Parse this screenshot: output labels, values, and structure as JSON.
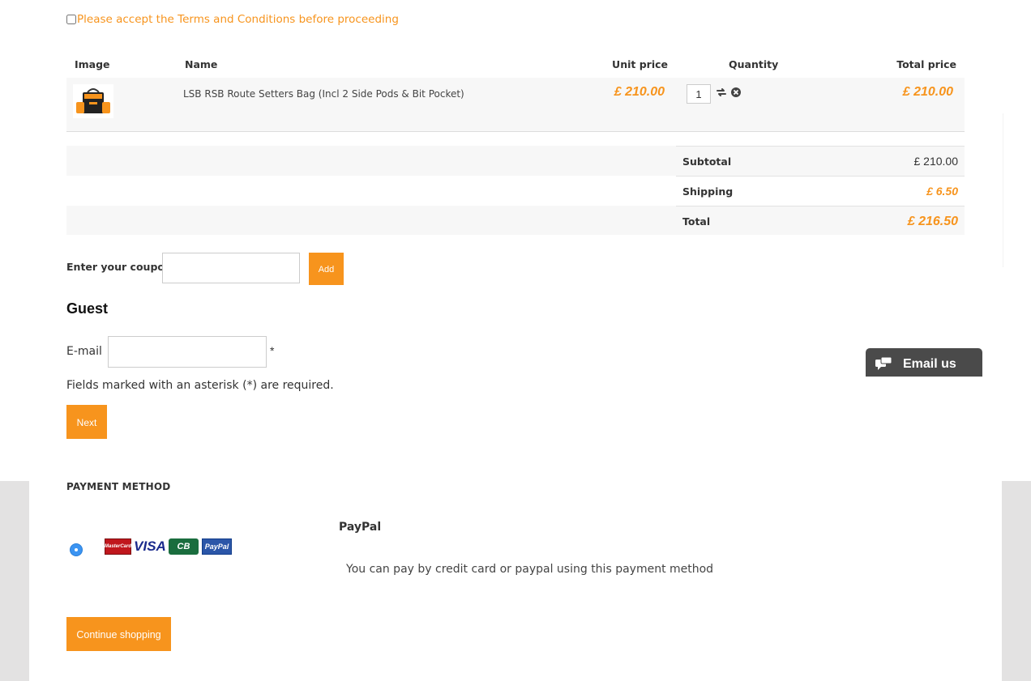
{
  "terms": {
    "label": "Please accept the Terms and Conditions before proceeding",
    "checked": false
  },
  "cart": {
    "headers": {
      "image": "Image",
      "name": "Name",
      "unit_price": "Unit price",
      "quantity": "Quantity",
      "total_price": "Total price"
    },
    "items": [
      {
        "name": "LSB RSB Route Setters Bag (Incl 2 Side Pods & Bit Pocket)",
        "unit_price": "£ 210.00",
        "quantity": "1",
        "total_price": "£ 210.00",
        "image_icon": "bag-product-image",
        "update_icon": "refresh-icon",
        "remove_icon": "remove-icon"
      }
    ]
  },
  "summary": {
    "subtotal_label": "Subtotal",
    "subtotal": "£ 210.00",
    "shipping_label": "Shipping",
    "shipping": "£ 6.50",
    "total_label": "Total",
    "total": "£ 216.50"
  },
  "coupon": {
    "label": "Enter your coupon",
    "value": "",
    "add_label": "Add"
  },
  "guest": {
    "title": "Guest",
    "email_label": "E-mail",
    "email_value": "",
    "required_star": "*",
    "required_note": "Fields marked with an asterisk (*) are required.",
    "next_label": "Next"
  },
  "widget": {
    "email_us": "Email us",
    "icon": "chat-icon"
  },
  "payment": {
    "title": "PAYMENT METHOD",
    "method_name": "PayPal",
    "method_desc": "You can pay by credit card or paypal using this payment method",
    "selected": true,
    "cards": {
      "mastercard": "MasterCard",
      "visa": "VISA",
      "cb": "CB",
      "paypal": "PayPal"
    }
  },
  "footer": {
    "continue_label": "Continue shopping"
  },
  "colors": {
    "accent": "#f7941d",
    "panel_bg": "#e3e2e2",
    "radio": "#3b94f2"
  }
}
